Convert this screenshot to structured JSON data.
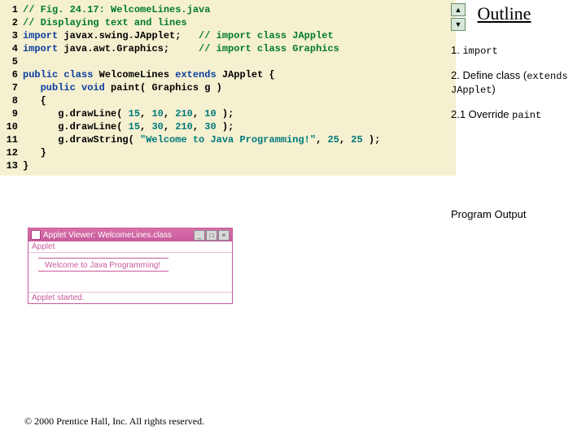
{
  "code": {
    "lines": [
      {
        "n": "1",
        "segments": [
          {
            "cls": "cm",
            "t": "// Fig. 24.17: WelcomeLines.java"
          }
        ]
      },
      {
        "n": "2",
        "segments": [
          {
            "cls": "cm",
            "t": "// Displaying text and lines"
          }
        ]
      },
      {
        "n": "3",
        "segments": [
          {
            "cls": "kw",
            "t": "import"
          },
          {
            "cls": "",
            "t": " javax.swing.JApplet;   "
          },
          {
            "cls": "cm",
            "t": "// import class JApplet"
          }
        ]
      },
      {
        "n": "4",
        "segments": [
          {
            "cls": "kw",
            "t": "import"
          },
          {
            "cls": "",
            "t": " java.awt.Graphics;     "
          },
          {
            "cls": "cm",
            "t": "// import class Graphics"
          }
        ]
      },
      {
        "n": "5",
        "segments": []
      },
      {
        "n": "6",
        "segments": [
          {
            "cls": "kw",
            "t": "public class "
          },
          {
            "cls": "",
            "t": "WelcomeLines "
          },
          {
            "cls": "kw",
            "t": "extends"
          },
          {
            "cls": "",
            "t": " JApplet {"
          }
        ]
      },
      {
        "n": "7",
        "segments": [
          {
            "cls": "",
            "t": "   "
          },
          {
            "cls": "kw",
            "t": "public void"
          },
          {
            "cls": "",
            "t": " paint( Graphics g )"
          }
        ]
      },
      {
        "n": "8",
        "segments": [
          {
            "cls": "",
            "t": "   {"
          }
        ]
      },
      {
        "n": "9",
        "segments": [
          {
            "cls": "",
            "t": "      g.drawLine( "
          },
          {
            "cls": "st",
            "t": "15"
          },
          {
            "cls": "",
            "t": ", "
          },
          {
            "cls": "st",
            "t": "10"
          },
          {
            "cls": "",
            "t": ", "
          },
          {
            "cls": "st",
            "t": "210"
          },
          {
            "cls": "",
            "t": ", "
          },
          {
            "cls": "st",
            "t": "10"
          },
          {
            "cls": "",
            "t": " );"
          }
        ]
      },
      {
        "n": "10",
        "segments": [
          {
            "cls": "",
            "t": "      g.drawLine( "
          },
          {
            "cls": "st",
            "t": "15"
          },
          {
            "cls": "",
            "t": ", "
          },
          {
            "cls": "st",
            "t": "30"
          },
          {
            "cls": "",
            "t": ", "
          },
          {
            "cls": "st",
            "t": "210"
          },
          {
            "cls": "",
            "t": ", "
          },
          {
            "cls": "st",
            "t": "30"
          },
          {
            "cls": "",
            "t": " );"
          }
        ]
      },
      {
        "n": "11",
        "segments": [
          {
            "cls": "",
            "t": "      g.drawString( "
          },
          {
            "cls": "st",
            "t": "\"Welcome to Java Programming!\""
          },
          {
            "cls": "",
            "t": ", "
          },
          {
            "cls": "st",
            "t": "25"
          },
          {
            "cls": "",
            "t": ", "
          },
          {
            "cls": "st",
            "t": "25"
          },
          {
            "cls": "",
            "t": " );"
          }
        ]
      },
      {
        "n": "12",
        "segments": [
          {
            "cls": "",
            "t": "   }"
          }
        ]
      },
      {
        "n": "13",
        "segments": [
          {
            "cls": "",
            "t": "}"
          }
        ]
      }
    ]
  },
  "outline": {
    "title": "Outline",
    "items": [
      {
        "plain": "1. ",
        "mono": "import"
      },
      {
        "plain": "2. Define class (",
        "mono": "extends JApplet",
        "suffix": ")"
      },
      {
        "plain": "2.1 Override ",
        "mono": "paint"
      }
    ]
  },
  "programOutputLabel": "Program Output",
  "applet": {
    "title": "Applet Viewer: WelcomeLines.class",
    "menu": "Applet",
    "bodyText": "Welcome to Java Programming!",
    "status": "Applet started."
  },
  "copyright": "© 2000 Prentice Hall, Inc. All rights reserved."
}
